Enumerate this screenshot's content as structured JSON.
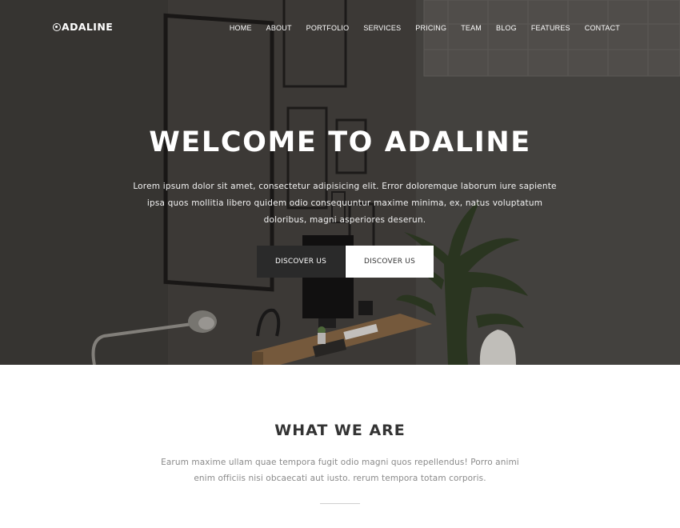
{
  "brand": {
    "logo_text": "ADALINE"
  },
  "nav": {
    "items": [
      "HOME",
      "ABOUT",
      "PORTFOLIO",
      "SERVICES",
      "PRICING",
      "TEAM",
      "BLOG",
      "FEATURES",
      "CONTACT"
    ]
  },
  "hero": {
    "title": "WELCOME TO ADALINE",
    "text": "Lorem ipsum dolor sit amet, consectetur adipisicing elit. Error doloremque laborum iure sapiente ipsa quos mollitia libero quidem odio consequuntur maxime minima, ex, natus voluptatum doloribus, magni asperiores deserun.",
    "primary_button": "DISCOVER US",
    "secondary_button": "DISCOVER US"
  },
  "about": {
    "title": "WHAT WE ARE",
    "text": "Earum maxime ullam quae tempora fugit odio magni quos repellendus! Porro animi enim officiis nisi obcaecati aut iusto. rerum tempora totam corporis."
  },
  "colors": {
    "primary_button_bg": "#2a2a2a",
    "secondary_button_bg": "#ffffff",
    "hero_text": "#ffffff",
    "body_text": "#8a8a8a"
  }
}
